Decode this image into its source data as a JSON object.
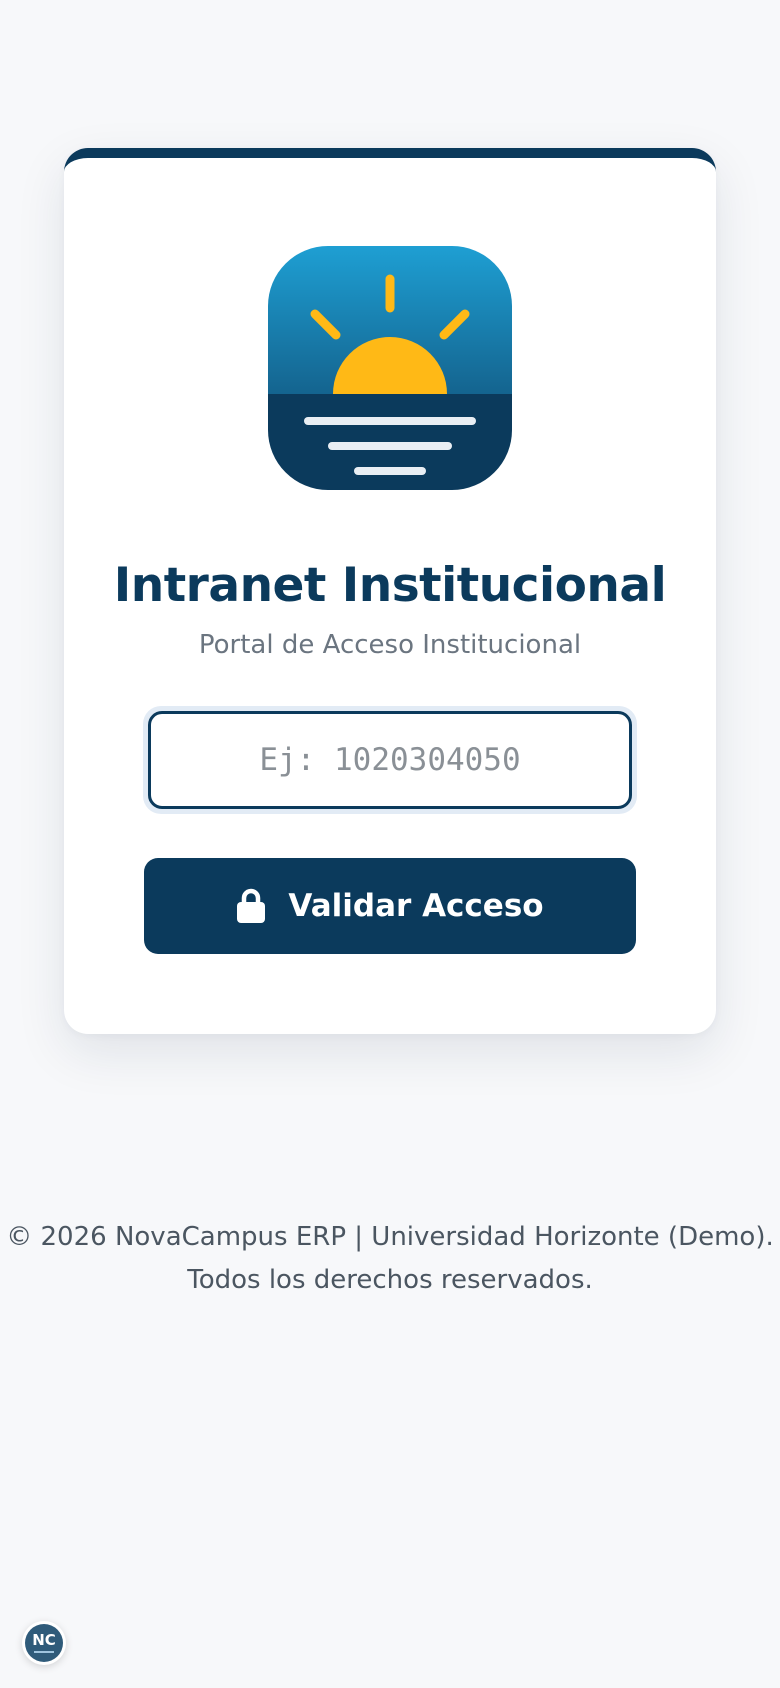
{
  "login": {
    "title": "Intranet Institucional",
    "subtitle": "Portal de Acceso Institucional",
    "id_field": {
      "value": "",
      "placeholder": "Ej: 1020304050"
    },
    "submit_label": "Validar Acceso",
    "submit_icon": "lock-icon",
    "logo_icon": "sunrise-logo-icon"
  },
  "footer": {
    "line1": "© 2026 NovaCampus ERP | Universidad Horizonte (Demo).",
    "line2": "Todos los derechos reservados."
  },
  "badge": {
    "label": "NC"
  },
  "colors": {
    "primary": "#0b3a5c",
    "accent_sun": "#ffb916",
    "background": "#f7f8fa",
    "logo_sky_top": "#1e9fd3",
    "logo_water": "#0b3a5c"
  }
}
